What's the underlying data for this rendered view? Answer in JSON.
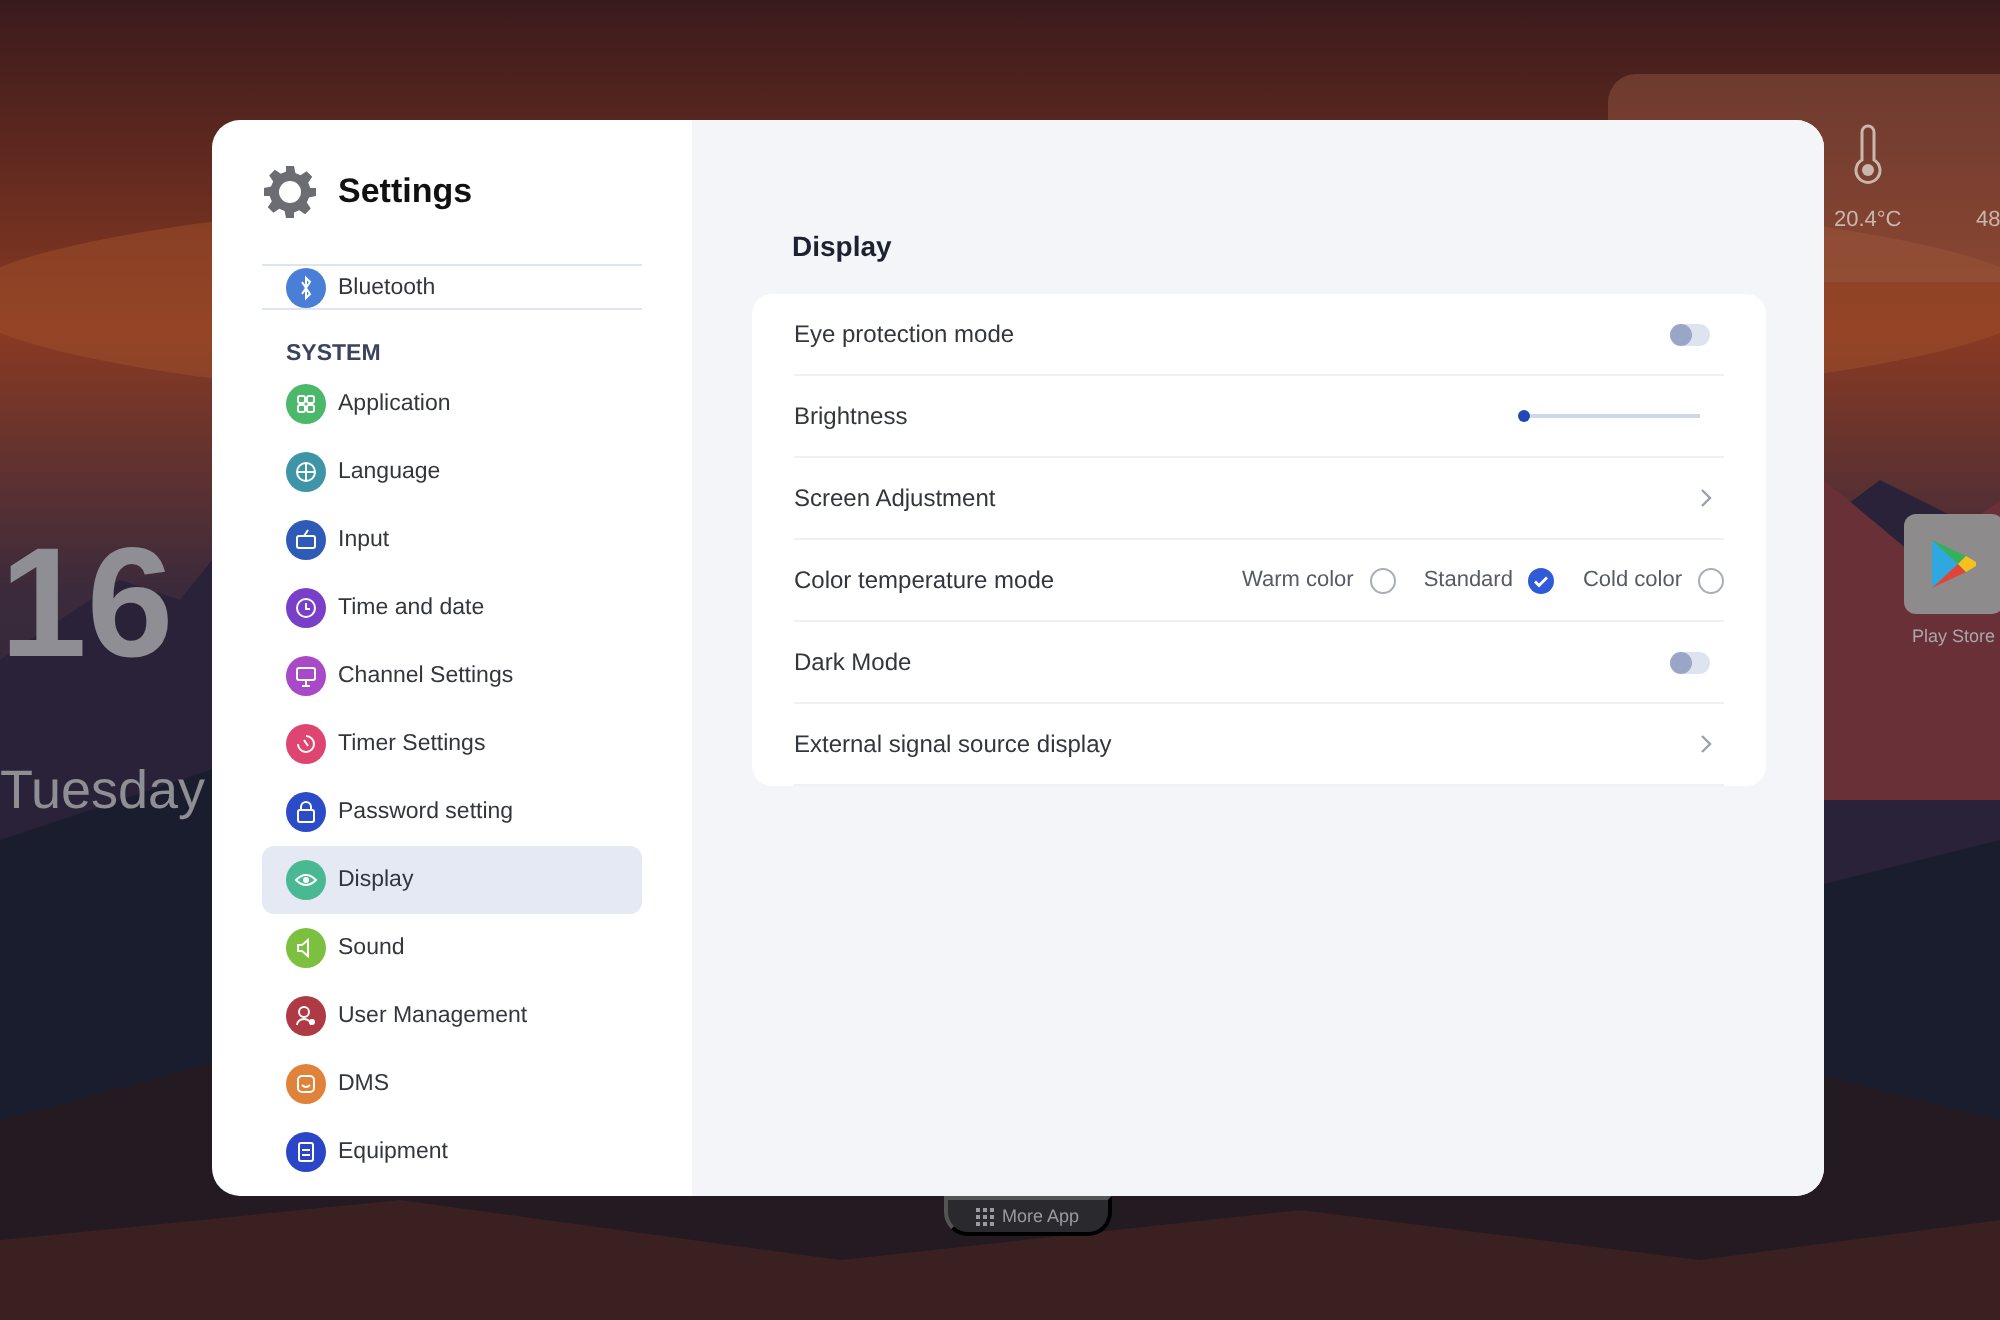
{
  "desktop": {
    "day": "16",
    "weekday": "Tuesday",
    "weather": {
      "temperature": "20.4°C",
      "reading_2": "48"
    },
    "apps": [
      {
        "label": "Play Store"
      }
    ],
    "dock": {
      "label": "More App"
    }
  },
  "settings": {
    "title": "Settings",
    "sidebar": {
      "groups": [
        {
          "items": [
            {
              "label": "Bluetooth",
              "color": "#4a7fd8",
              "selected": false
            }
          ]
        },
        {
          "heading": "SYSTEM",
          "items": [
            {
              "label": "Application",
              "color": "#4bb86a",
              "selected": false
            },
            {
              "label": "Language",
              "color": "#3e95a8",
              "selected": false
            },
            {
              "label": "Input",
              "color": "#2f5bb8",
              "selected": false
            },
            {
              "label": "Time and date",
              "color": "#7a3fc8",
              "selected": false
            },
            {
              "label": "Channel Settings",
              "color": "#a84ac8",
              "selected": false
            },
            {
              "label": "Timer Settings",
              "color": "#de4570",
              "selected": false
            },
            {
              "label": "Password setting",
              "color": "#2c4bc8",
              "selected": false
            },
            {
              "label": "Display",
              "color": "#4bb894",
              "selected": true
            },
            {
              "label": "Sound",
              "color": "#7cc040",
              "selected": false
            },
            {
              "label": "User Management",
              "color": "#b03a44",
              "selected": false
            },
            {
              "label": "DMS",
              "color": "#e0823a",
              "selected": false
            },
            {
              "label": "Equipment",
              "color": "#2a45c8",
              "selected": false
            }
          ]
        }
      ]
    },
    "page": {
      "title": "Display",
      "rows": [
        {
          "kind": "toggle",
          "label": "Eye protection mode",
          "on": false
        },
        {
          "kind": "slider",
          "label": "Brightness",
          "level": 0.02
        },
        {
          "kind": "link",
          "label": "Screen Adjustment"
        },
        {
          "kind": "radio",
          "label": "Color temperature mode",
          "options": [
            {
              "label": "Warm color",
              "selected": false
            },
            {
              "label": "Standard",
              "selected": true
            },
            {
              "label": "Cold color",
              "selected": false
            }
          ]
        },
        {
          "kind": "toggle",
          "label": "Dark Mode",
          "on": false
        },
        {
          "kind": "link",
          "label": "External signal source display"
        }
      ]
    }
  }
}
